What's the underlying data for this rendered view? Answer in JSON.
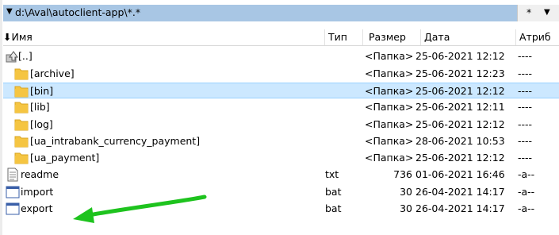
{
  "path_bar": {
    "path": "d:\\Aval\\autoclient-app\\*.*",
    "filter_glyph": "*",
    "dropdown_glyph": "▼"
  },
  "columns": {
    "name": "Имя",
    "name_sort_glyph": "⬇",
    "type": "Тип",
    "size": "Размер",
    "date": "Дата",
    "attributes": "Атриб"
  },
  "rows": [
    {
      "kind": "up",
      "name": "[..]",
      "type": "",
      "size": "<Папка>",
      "date": "25-06-2021 12:12",
      "attr": "----"
    },
    {
      "kind": "folder",
      "name": "[archive]",
      "type": "",
      "size": "<Папка>",
      "date": "25-06-2021 12:23",
      "attr": "----"
    },
    {
      "kind": "folder",
      "name": "[bin]",
      "type": "",
      "size": "<Папка>",
      "date": "25-06-2021 12:12",
      "attr": "----",
      "selected": true
    },
    {
      "kind": "folder",
      "name": "[lib]",
      "type": "",
      "size": "<Папка>",
      "date": "25-06-2021 12:11",
      "attr": "----"
    },
    {
      "kind": "folder",
      "name": "[log]",
      "type": "",
      "size": "<Папка>",
      "date": "25-06-2021 12:12",
      "attr": "----"
    },
    {
      "kind": "folder",
      "name": "[ua_intrabank_currency_payment]",
      "type": "",
      "size": "<Папка>",
      "date": "28-06-2021 10:53",
      "attr": "----"
    },
    {
      "kind": "folder",
      "name": "[ua_payment]",
      "type": "",
      "size": "<Папка>",
      "date": "25-06-2021 12:12",
      "attr": "----"
    },
    {
      "kind": "text",
      "name": "readme",
      "type": "txt",
      "size": "736",
      "date": "01-06-2021 16:46",
      "attr": "-a--"
    },
    {
      "kind": "batch",
      "name": "import",
      "type": "bat",
      "size": "30",
      "date": "26-04-2021 14:17",
      "attr": "-a--"
    },
    {
      "kind": "batch",
      "name": "export",
      "type": "bat",
      "size": "30",
      "date": "26-04-2021 14:17",
      "attr": "-a--"
    }
  ],
  "colors": {
    "path_bar": "#a8c6e4",
    "selection": "#cce8ff",
    "folder": "#f5c542",
    "annotation_arrow": "#1ec31e"
  }
}
